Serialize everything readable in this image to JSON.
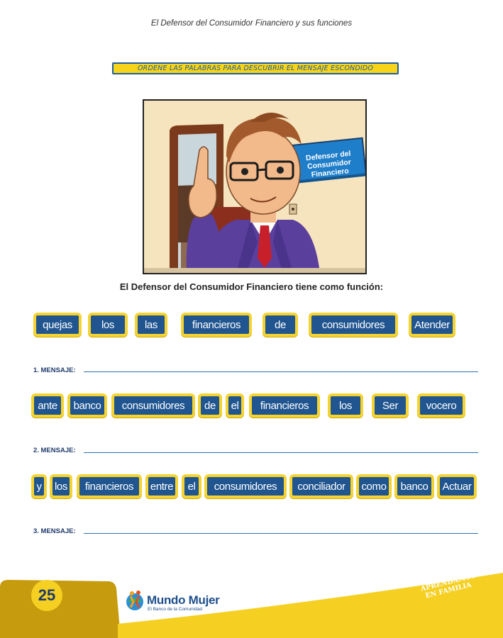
{
  "header": {
    "title": "El Defensor del Consumidor Financiero y sus funciones"
  },
  "instruction": "ORDENE LAS PALABRAS PARA DESCUBRIR EL MENSAJE ESCONDIDO",
  "illustration": {
    "sign_line1": "Defensor del",
    "sign_line2": "Consumidor",
    "sign_line3": "Financiero"
  },
  "subtitle": "El Defensor del Consumidor Financiero tiene como función:",
  "exercises": [
    {
      "words": [
        "quejas",
        "los",
        "las",
        "financieros",
        "de",
        "consumidores",
        "Atender"
      ],
      "label": "1. MENSAJE:"
    },
    {
      "words": [
        "ante",
        "banco",
        "consumidores",
        "de",
        "el",
        "financieros",
        "los",
        "Ser",
        "vocero"
      ],
      "label": "2. MENSAJE:"
    },
    {
      "words": [
        "y",
        "los",
        "financieros",
        "entre",
        "el",
        "consumidores",
        "conciliador",
        "como",
        "banco",
        "Actuar"
      ],
      "label": "3. MENSAJE:"
    }
  ],
  "footer": {
    "page_number": "25",
    "logo_name": "Mundo Mujer",
    "logo_tagline": "El Banco de la Comunidad",
    "slogan_line1": "APRENDAMOS",
    "slogan_line2": "EN FAMILIA"
  },
  "colors": {
    "accent_yellow": "#f5d330",
    "word_blue": "#20558f",
    "line_blue": "#2f6fb0"
  }
}
